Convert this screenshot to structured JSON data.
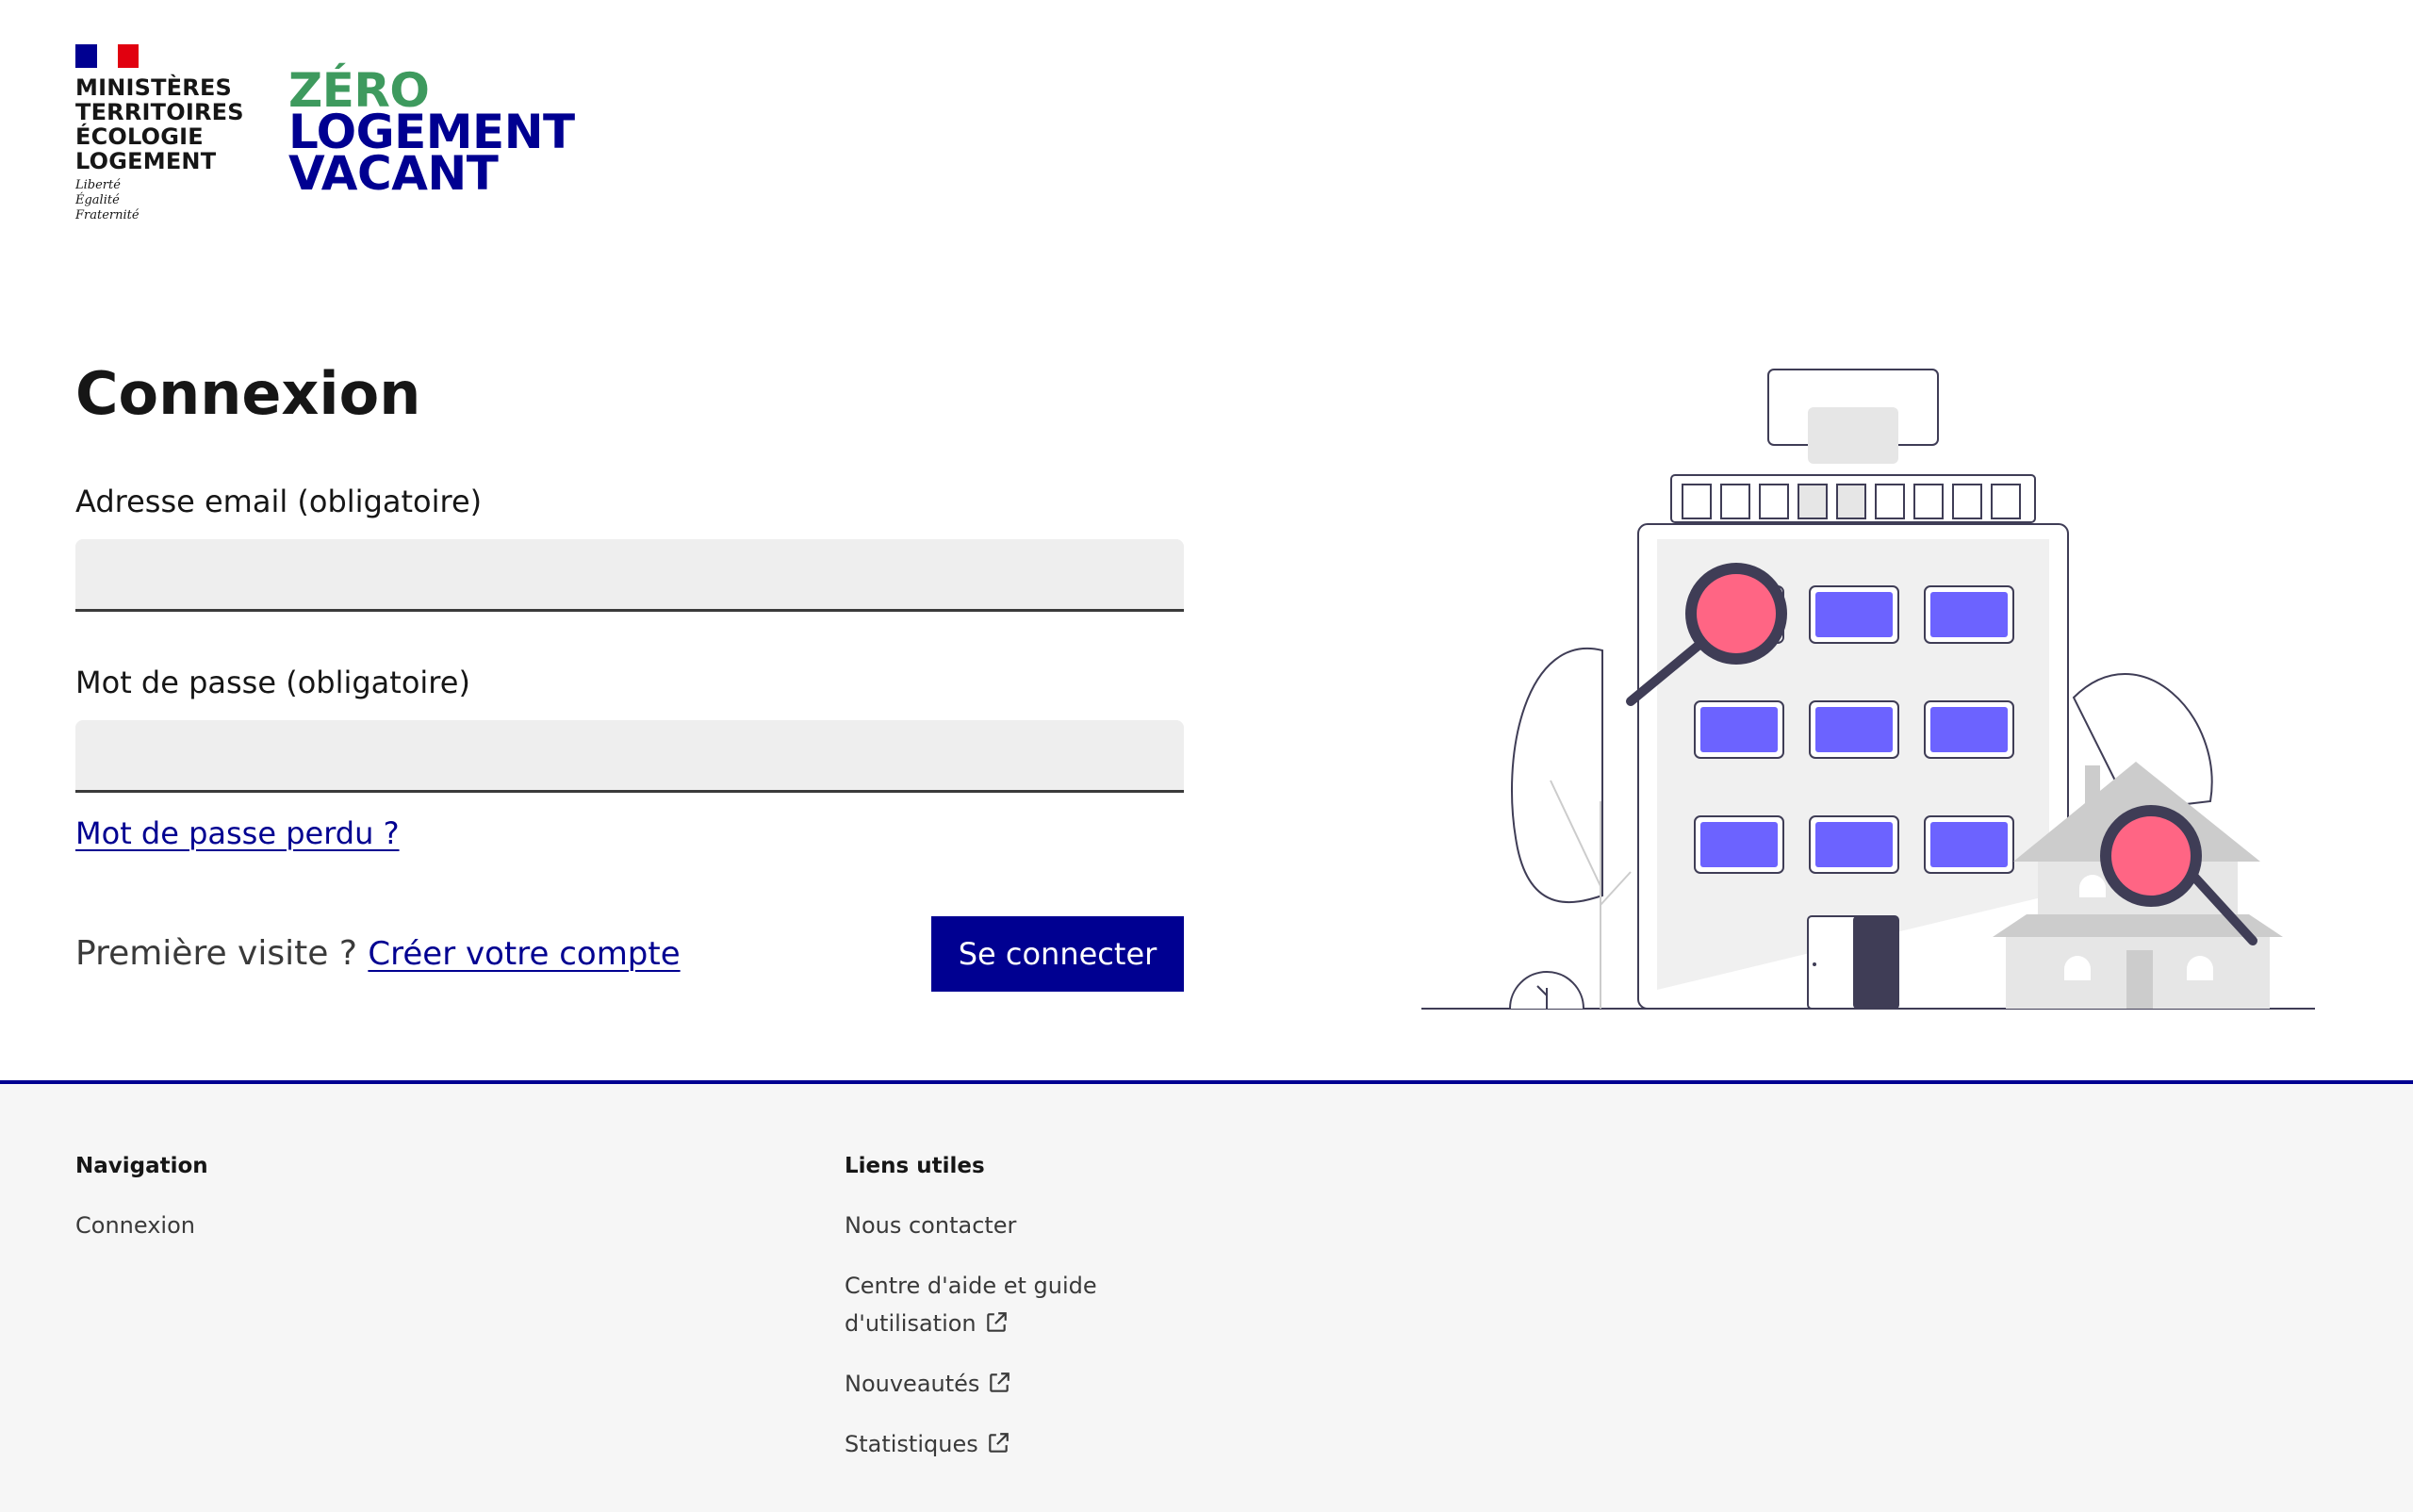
{
  "header": {
    "ministry_lines": [
      "MINISTÈRES",
      "TERRITOIRES",
      "ÉCOLOGIE",
      "LOGEMENT"
    ],
    "motto_lines": [
      "Liberté",
      "Égalité",
      "Fraternité"
    ],
    "product_lines": [
      "ZÉRO",
      "LOGEMENT",
      "VACANT"
    ]
  },
  "main": {
    "title": "Connexion",
    "email_label": "Adresse email (obligatoire)",
    "email_value": "",
    "password_label": "Mot de passe (obligatoire)",
    "password_value": "",
    "forgot_password": "Mot de passe perdu ?",
    "first_visit_text": "Première visite ?",
    "create_account": "Créer votre compte",
    "login_button": "Se connecter"
  },
  "footer": {
    "nav_heading": "Navigation",
    "nav_links": [
      "Connexion"
    ],
    "useful_heading": "Liens utiles",
    "useful_links": [
      {
        "label": "Nous contacter"
      },
      {
        "label_line1": "Centre d'aide et guide",
        "label_line2": "d'utilisation"
      },
      {
        "label": "Nouveautés"
      },
      {
        "label": "Statistiques"
      }
    ]
  },
  "colors": {
    "primary": "#000091",
    "logo_green": "#3e9a5e",
    "magnifier": "#ff6584",
    "window": "#6c63ff",
    "door": "#3f3d56"
  },
  "icons": [
    "external-link-icon",
    "marianne-flag-icon"
  ]
}
